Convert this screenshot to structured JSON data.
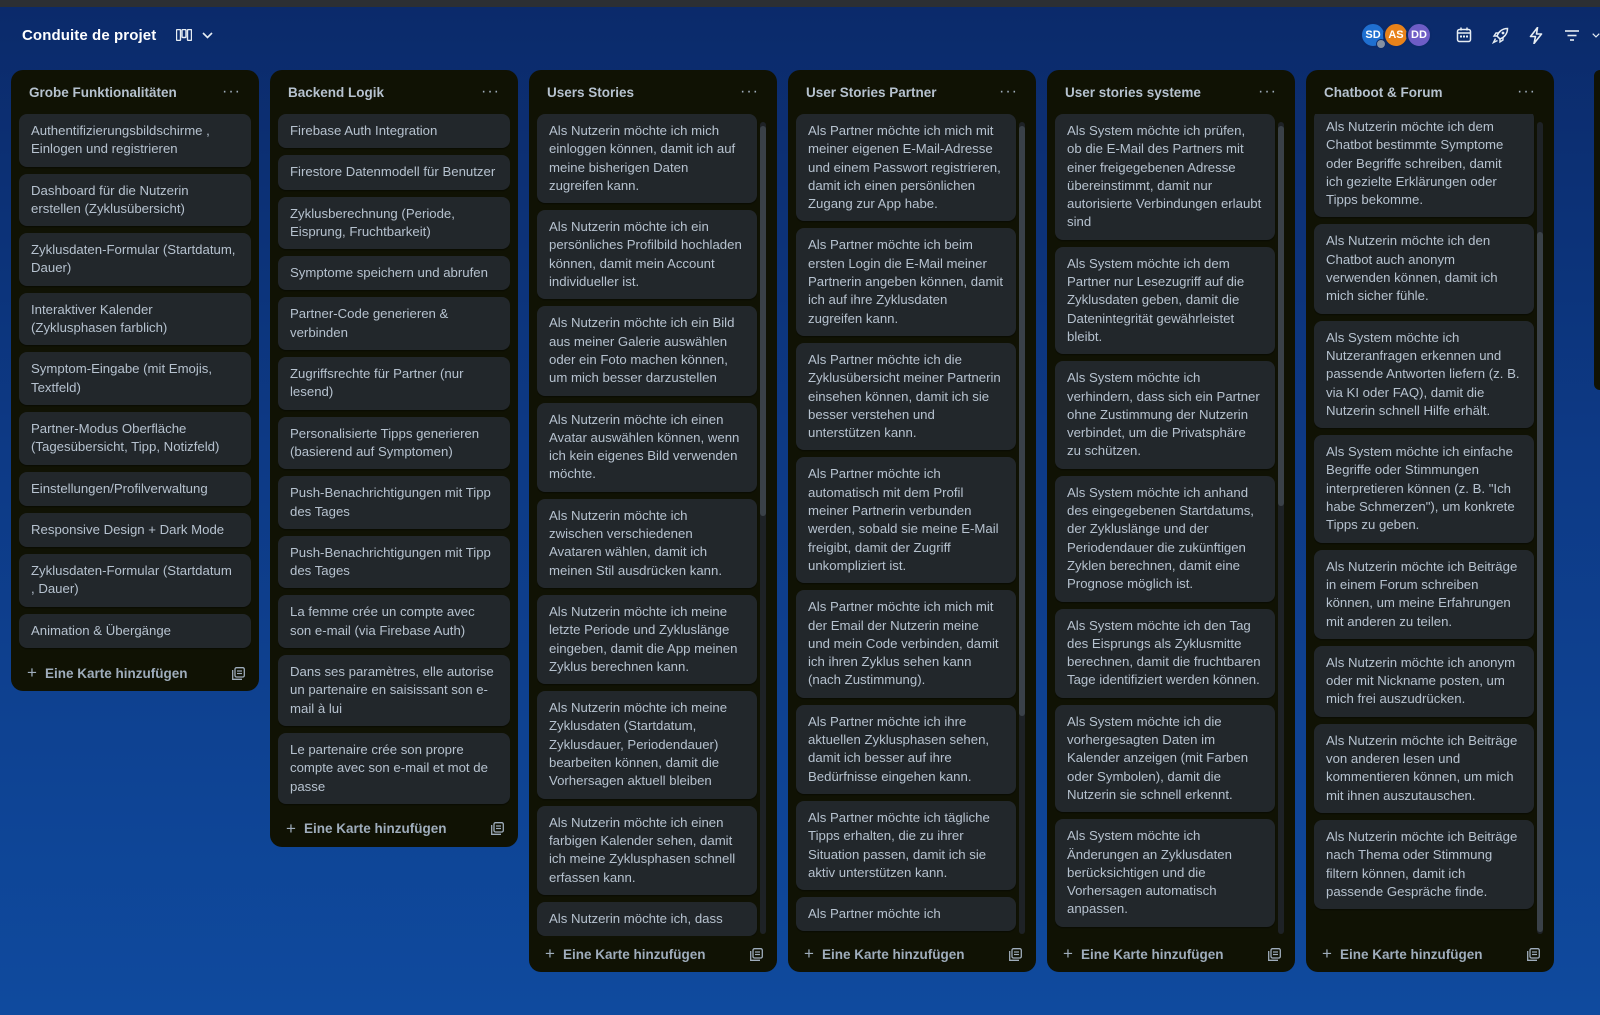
{
  "header": {
    "title": "Conduite de projet",
    "view_icon": "board-icon",
    "avatars": [
      {
        "initials": "SD",
        "color": "#1f6fd0"
      },
      {
        "initials": "AS",
        "color": "#e8821a"
      },
      {
        "initials": "DD",
        "color": "#6e5dc6"
      }
    ],
    "icons": [
      "calendar-icon",
      "rocket-icon",
      "lightning-icon",
      "filter-icon"
    ]
  },
  "add_card_label": "Eine Karte hinzufügen",
  "lists": [
    {
      "title": "Grobe Funktionalitäten",
      "cards": [
        "Authentifizierungsbildschirme , Einlogen und registrieren",
        "Dashboard für die Nutzerin erstellen (Zyklusübersicht)",
        "Zyklusdaten-Formular (Startdatum, Dauer)",
        "Interaktiver Kalender (Zyklusphasen farblich)",
        "Symptom-Eingabe (mit Emojis, Textfeld)",
        "Partner-Modus Oberfläche (Tagesübersicht, Tipp, Notizfeld)",
        "Einstellungen/Profilverwaltung",
        "Responsive Design + Dark Mode",
        "Zyklusdaten-Formular (Startdatum , Dauer)",
        "Animation & Übergänge"
      ]
    },
    {
      "title": "Backend Logik",
      "cards": [
        "Firebase Auth Integration",
        "Firestore Datenmodell für Benutzer",
        "Zyklusberechnung (Periode, Eisprung, Fruchtbarkeit)",
        "Symptome speichern und abrufen",
        "Partner-Code generieren & verbinden",
        "Zugriffsrechte für Partner (nur lesend)",
        "Personalisierte Tipps generieren (basierend auf Symptomen)",
        "Push-Benachrichtigungen mit Tipp des Tages",
        "Push-Benachrichtigungen mit Tipp des Tages",
        "La femme crée un compte avec son e-mail (via Firebase Auth)",
        "Dans ses paramètres, elle autorise un partenaire en saisissant son e-mail à lui",
        "Le partenaire crée son propre compte avec son e-mail et mot de passe"
      ]
    },
    {
      "title": "Users Stories",
      "cards": [
        "Als Nutzerin möchte ich mich einloggen können, damit ich auf meine bisherigen Daten zugreifen kann.",
        "Als Nutzerin möchte ich ein persönliches Profilbild hochladen können, damit mein Account individueller ist.",
        "Als Nutzerin möchte ich ein Bild aus meiner Galerie auswählen oder ein Foto machen können, um mich besser darzustellen",
        "Als Nutzerin möchte ich einen Avatar auswählen können, wenn ich kein eigenes Bild verwenden möchte.",
        "Als Nutzerin möchte ich zwischen verschiedenen Avataren wählen, damit ich meinen Stil ausdrücken kann.",
        "Als Nutzerin möchte ich meine letzte Periode und Zykluslänge eingeben, damit die App meinen Zyklus berechnen kann.",
        "Als Nutzerin möchte ich meine Zyklusdaten (Startdatum, Zyklusdauer, Periodendauer) bearbeiten können, damit die Vorhersagen aktuell bleiben",
        "Als Nutzerin möchte ich einen farbigen Kalender sehen, damit ich meine Zyklusphasen schnell erfassen kann.",
        "Als Nutzerin möchte ich, dass"
      ]
    },
    {
      "title": "User Stories Partner",
      "cards": [
        "Als Partner möchte ich mich mit meiner eigenen E-Mail-Adresse und einem Passwort registrieren, damit ich einen persönlichen Zugang zur App habe.",
        "Als Partner möchte ich beim ersten Login die E-Mail meiner Partnerin angeben können, damit ich auf ihre Zyklusdaten zugreifen kann.",
        "Als Partner möchte ich die Zyklusübersicht meiner Partnerin einsehen können, damit ich sie besser verstehen und unterstützen kann.",
        "Als Partner möchte ich automatisch mit dem Profil meiner Partnerin verbunden werden, sobald sie meine E-Mail freigibt, damit der Zugriff unkompliziert ist.",
        "Als Partner möchte ich mich mit der Email der Nutzerin meine und mein Code verbinden, damit ich ihren Zyklus sehen kann (nach Zustimmung).",
        "Als Partner möchte ich ihre aktuellen Zyklusphasen sehen, damit ich besser auf ihre Bedürfnisse eingehen kann.",
        "Als Partner möchte ich tägliche Tipps erhalten, die zu ihrer Situation passen, damit ich sie aktiv unterstützen kann.",
        "Als Partner möchte ich"
      ]
    },
    {
      "title": "User stories systeme",
      "cards": [
        "Als System möchte ich prüfen, ob die E-Mail des Partners mit einer freigegebenen Adresse übereinstimmt, damit nur autorisierte Verbindungen erlaubt sind",
        "Als System möchte ich dem Partner nur Lesezugriff auf die Zyklusdaten geben, damit die Datenintegrität gewährleistet bleibt.",
        "Als System möchte ich verhindern, dass sich ein Partner ohne Zustimmung der Nutzerin verbindet, um die Privatsphäre zu schützen.",
        "Als System möchte ich anhand des eingegebenen Startdatums, der Zykluslänge und der Periodendauer die zukünftigen Zyklen berechnen, damit eine Prognose möglich ist.",
        "Als System möchte ich den Tag des Eisprungs als Zyklusmitte berechnen, damit die fruchtbaren Tage identifiziert werden können.",
        "Als System möchte ich die vorhergesagten Daten im Kalender anzeigen (mit Farben oder Symbolen), damit die Nutzerin sie schnell erkennt.",
        "Als System möchte ich Änderungen an Zyklusdaten berücksichtigen und die Vorhersagen automatisch anpassen."
      ]
    },
    {
      "title": "Chatboot & Forum",
      "cards": [
        "Als Nutzerin möchte ich dem Chatbot bestimmte Symptome oder Begriffe schreiben, damit ich gezielte Erklärungen oder Tipps bekomme.",
        "Als Nutzerin möchte ich den Chatbot auch anonym verwenden können, damit ich mich sicher fühle.",
        "Als System möchte ich Nutzeranfragen erkennen und passende Antworten liefern (z. B. via KI oder FAQ), damit die Nutzerin schnell Hilfe erhält.",
        "Als System möchte ich einfache Begriffe oder Stimmungen interpretieren können (z. B. \"Ich habe Schmerzen\"), um konkrete Tipps zu geben.",
        "Als Nutzerin möchte ich Beiträge in einem Forum schreiben können, um meine Erfahrungen mit anderen zu teilen.",
        "Als Nutzerin möchte ich anonym oder mit Nickname posten, um mich frei auszudrücken.",
        "Als Nutzerin möchte ich Beiträge von anderen lesen und kommentieren können, um mich mit ihnen auszutauschen.",
        "Als Nutzerin möchte ich Beiträge nach Thema oder Stimmung filtern können, damit ich passende Gespräche finde."
      ]
    }
  ]
}
